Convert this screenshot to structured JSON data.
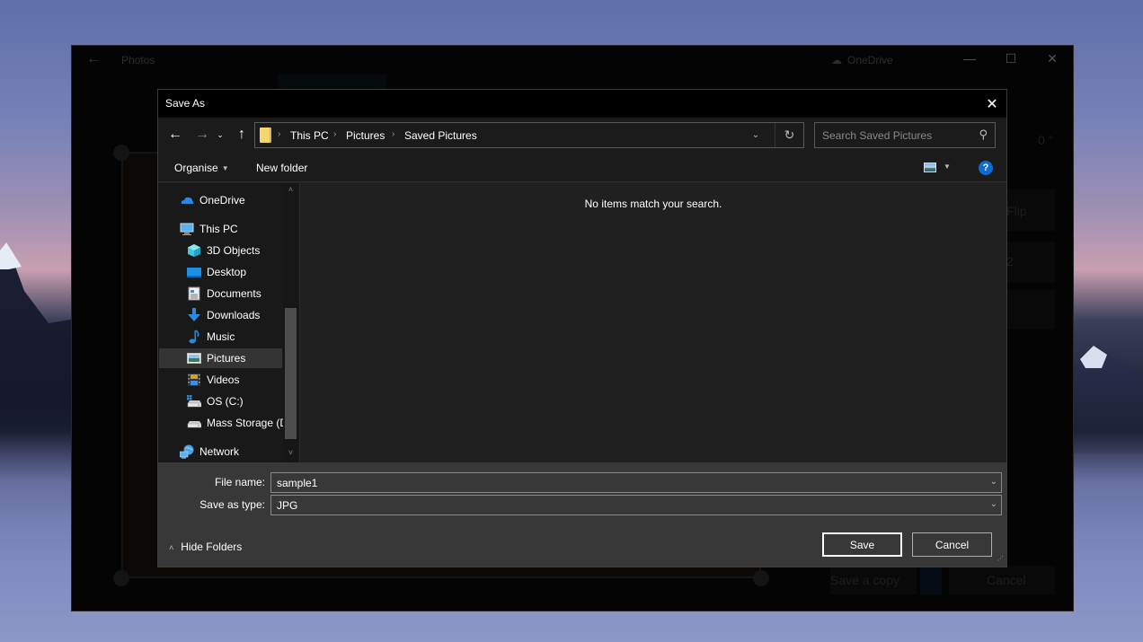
{
  "photos_window": {
    "title": "Photos",
    "onedrive_label": "OneDrive",
    "rotation_value": "0 °",
    "flip_label": "Flip",
    "aspect_value": "2",
    "save_copy_label": "Save a copy",
    "cancel_label": "Cancel",
    "controls": {
      "back": "←",
      "minimize": "—",
      "maximize": "☐",
      "close": "✕"
    }
  },
  "dialog": {
    "title": "Save As",
    "close_glyph": "✕",
    "nav": {
      "back": "←",
      "forward": "→",
      "recent": "⌄",
      "up": "↑"
    },
    "breadcrumb": [
      "This PC",
      "Pictures",
      "Saved Pictures"
    ],
    "breadcrumb_separator": "›",
    "address_dropdown": "⌄",
    "refresh_glyph": "↻",
    "search": {
      "placeholder": "Search Saved Pictures",
      "value": ""
    },
    "search_glyph": "⚲",
    "toolbar": {
      "organise_label": "Organise",
      "new_folder_label": "New folder",
      "caret": "▼",
      "help": "?"
    },
    "navigation": [
      {
        "label": "OneDrive",
        "icon": "onedrive-icon",
        "level": 0
      },
      {
        "label": "This PC",
        "icon": "this-pc-icon",
        "level": 0
      },
      {
        "label": "3D Objects",
        "icon": "3d-objects-icon",
        "level": 1
      },
      {
        "label": "Desktop",
        "icon": "desktop-icon",
        "level": 1
      },
      {
        "label": "Documents",
        "icon": "documents-icon",
        "level": 1
      },
      {
        "label": "Downloads",
        "icon": "downloads-icon",
        "level": 1
      },
      {
        "label": "Music",
        "icon": "music-icon",
        "level": 1
      },
      {
        "label": "Pictures",
        "icon": "pictures-icon",
        "level": 1,
        "selected": true
      },
      {
        "label": "Videos",
        "icon": "videos-icon",
        "level": 1
      },
      {
        "label": "OS (C:)",
        "icon": "os-drive-icon",
        "level": 1
      },
      {
        "label": "Mass Storage (D:)",
        "icon": "drive-icon",
        "level": 1
      },
      {
        "label": "Network",
        "icon": "network-icon",
        "level": 0
      }
    ],
    "scroll_up": "˄",
    "scroll_down": "˅",
    "empty_message": "No items match your search.",
    "file_name_label": "File name:",
    "file_name_value": "sample1",
    "save_as_type_label": "Save as type:",
    "save_as_type_value": "JPG",
    "field_caret": "⌄",
    "hide_folders_label": "Hide Folders",
    "hide_folders_caret": "˄",
    "save_label": "Save",
    "cancel_label": "Cancel"
  }
}
